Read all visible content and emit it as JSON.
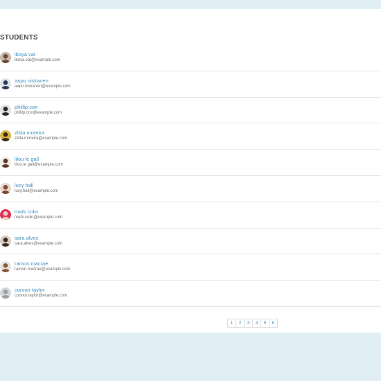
{
  "header": {
    "title": "STUDENTS"
  },
  "students": [
    {
      "name": "iboya vat",
      "email": "iboya.vat@example.com",
      "avatar_bg": "#c9b8aa",
      "avatar_fg": "#6b4a36"
    },
    {
      "name": "aapo niskanen",
      "email": "aapo.niskanen@example.com",
      "avatar_bg": "#dfe4ea",
      "avatar_fg": "#2b3a55"
    },
    {
      "name": "phillip cox",
      "email": "phillip.cox@example.com",
      "avatar_bg": "#e2e2e2",
      "avatar_fg": "#2a2a2a"
    },
    {
      "name": "zilda moreira",
      "email": "zilda.moreira@example.com",
      "avatar_bg": "#d8b640",
      "avatar_fg": "#3a2a12"
    },
    {
      "name": "lilou le gall",
      "email": "lilou.le gall@example.com",
      "avatar_bg": "#f0ece6",
      "avatar_fg": "#5a3a2a"
    },
    {
      "name": "lucy hall",
      "email": "lucy.hall@example.com",
      "avatar_bg": "#e8d8cc",
      "avatar_fg": "#7a4a35"
    },
    {
      "name": "mark colin",
      "email": "mark.colin@example.com",
      "avatar_bg": "#e0305a",
      "avatar_fg": "#f0d0c0"
    },
    {
      "name": "sara alves",
      "email": "sara.alves@example.com",
      "avatar_bg": "#d6cfc8",
      "avatar_fg": "#3a2a22"
    },
    {
      "name": "ramon macrae",
      "email": "ramon.macrae@example.com",
      "avatar_bg": "#e8e4de",
      "avatar_fg": "#8a5a3a"
    },
    {
      "name": "connor taylor",
      "email": "connor.taylor@example.com",
      "avatar_bg": "#d4d8dc",
      "avatar_fg": "#9aa0a6"
    }
  ],
  "pagination": {
    "pages": [
      "1",
      "2",
      "3",
      "4",
      "5",
      "6"
    ]
  }
}
